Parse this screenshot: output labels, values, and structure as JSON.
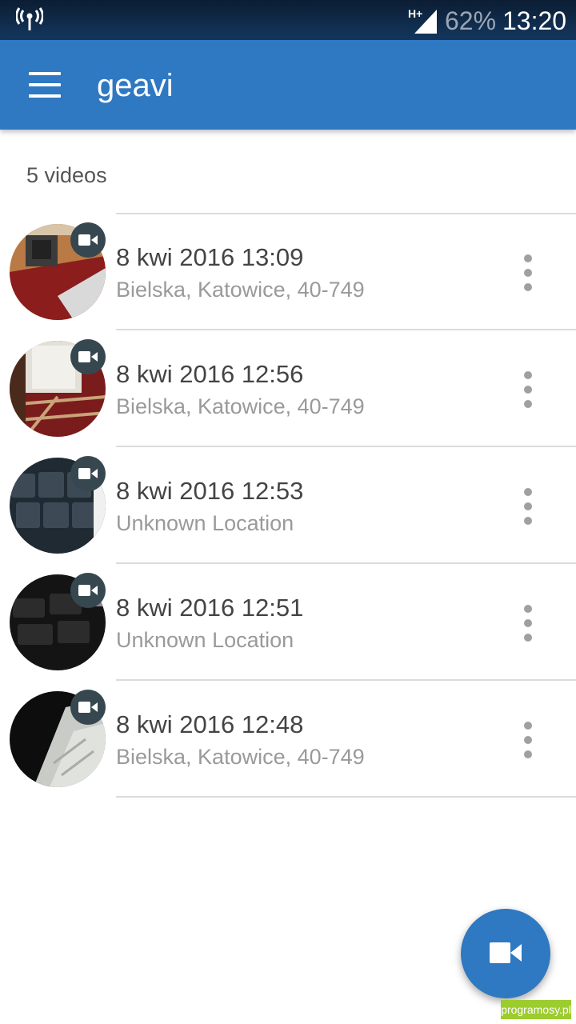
{
  "status_bar": {
    "network_type": "H+",
    "battery": "62%",
    "time": "13:20"
  },
  "app_bar": {
    "title": "geavi",
    "menu_icon": "hamburger-menu-icon"
  },
  "list": {
    "count_label": "5 videos",
    "items": [
      {
        "date": "8 kwi 2016 13:09",
        "location": "Bielska, Katowice, 40-749"
      },
      {
        "date": "8 kwi 2016 12:56",
        "location": "Bielska, Katowice, 40-749"
      },
      {
        "date": "8 kwi 2016 12:53",
        "location": "Unknown Location"
      },
      {
        "date": "8 kwi 2016 12:51",
        "location": "Unknown Location"
      },
      {
        "date": "8 kwi 2016 12:48",
        "location": "Bielska, Katowice, 40-749"
      }
    ]
  },
  "fab": {
    "icon": "videocam-icon"
  },
  "watermark": {
    "text": "programosy.pl"
  },
  "colors": {
    "primary": "#2f78c2",
    "status_bar": "#14375e",
    "badge": "#37474f"
  }
}
